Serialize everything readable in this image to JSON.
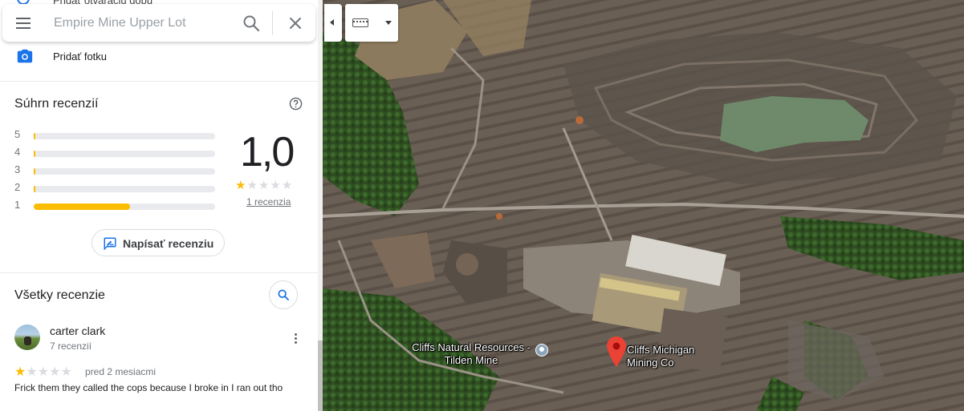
{
  "search": {
    "placeholder": "Empire Mine Upper Lot"
  },
  "panel": {
    "top_cut_text": "Pridať otváraciu dobu",
    "add_photo_label": "Pridať fotku"
  },
  "summary": {
    "title": "Súhrn recenzií",
    "rows": [
      {
        "stars": "5",
        "fraction": 0.0
      },
      {
        "stars": "4",
        "fraction": 0.0
      },
      {
        "stars": "3",
        "fraction": 0.0
      },
      {
        "stars": "2",
        "fraction": 0.0
      },
      {
        "stars": "1",
        "fraction": 0.53
      }
    ],
    "average": "1,0",
    "stars_filled": 1,
    "stars_total": 5,
    "review_count_link": "1 recenzia",
    "write_review_label": "Napísať recenziu"
  },
  "reviews": {
    "title": "Všetky recenzie",
    "items": [
      {
        "name": "carter clark",
        "meta": "7 recenzií",
        "stars": 1,
        "date": "pred 2 mesiacmi",
        "text": "Frick them they called the cops because I broke in I ran out tho"
      }
    ]
  },
  "map": {
    "labels": {
      "tilden": "Cliffs Natural Resources - Tilden Mine",
      "cliffs": "Cliffs Michigan Mining Co"
    }
  },
  "colors": {
    "accent_blue": "#1a73e8",
    "star_yellow": "#fbbc04",
    "pin_red": "#ea4335"
  }
}
